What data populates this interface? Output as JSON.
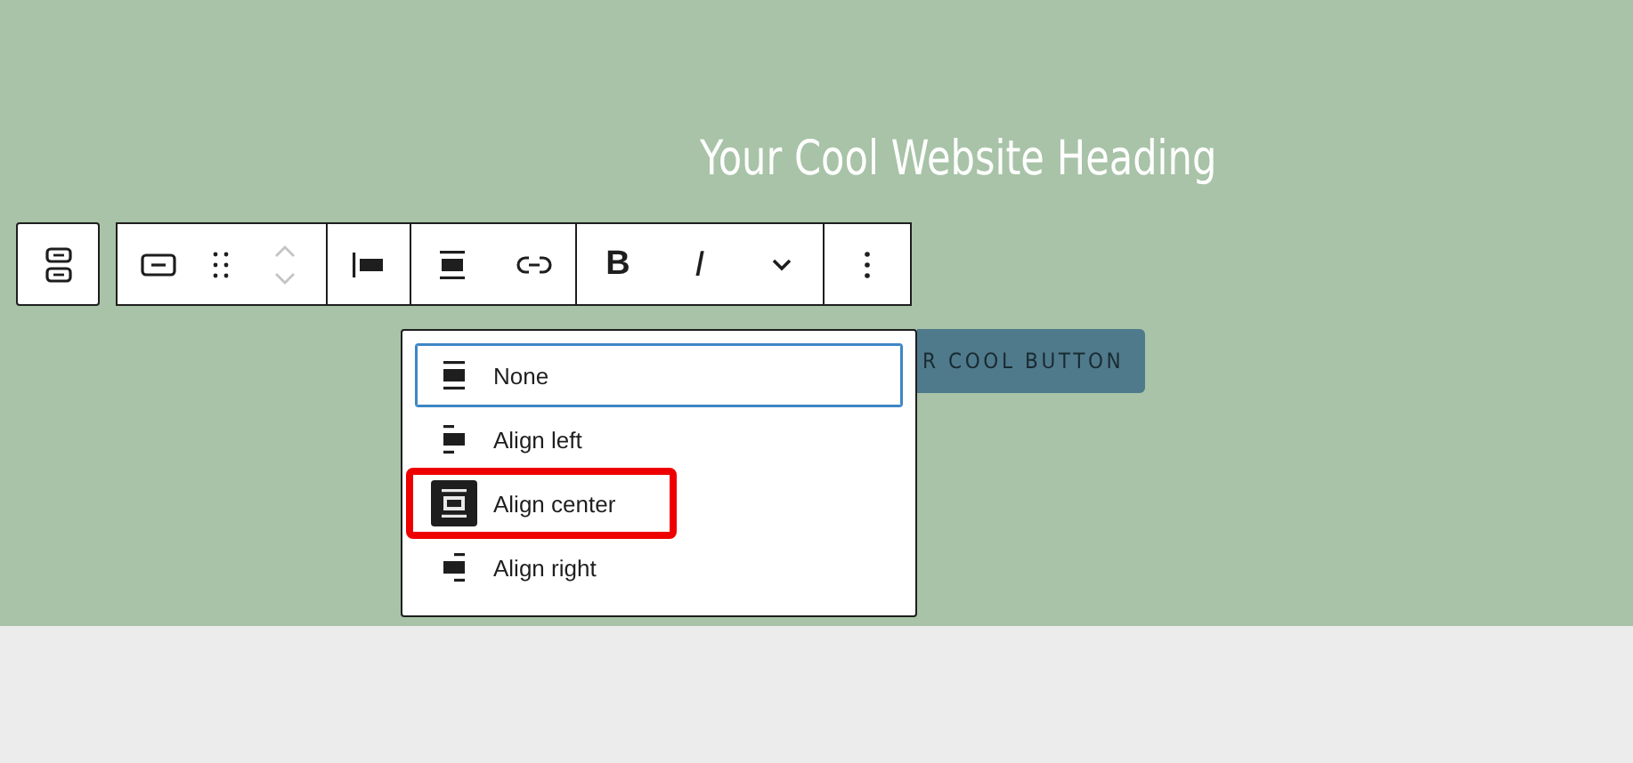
{
  "heading": "Your Cool Website Heading",
  "button": {
    "label": "R COOL BUTTON"
  },
  "toolbar": {
    "items": [
      {
        "kind": "parent"
      },
      {
        "kind": "block"
      },
      {
        "kind": "drag"
      },
      {
        "kind": "mover"
      },
      {
        "kind": "align-left"
      },
      {
        "kind": "align-center"
      },
      {
        "kind": "link"
      },
      {
        "kind": "bold",
        "label": "B"
      },
      {
        "kind": "italic",
        "label": "I"
      },
      {
        "kind": "more-caret"
      },
      {
        "kind": "options"
      }
    ]
  },
  "align_menu": {
    "items": [
      {
        "label": "None",
        "kind": "none",
        "selected": false,
        "focused": true,
        "marked": false
      },
      {
        "label": "Align left",
        "kind": "left",
        "selected": false,
        "focused": false,
        "marked": false
      },
      {
        "label": "Align center",
        "kind": "center",
        "selected": true,
        "focused": false,
        "marked": true
      },
      {
        "label": "Align right",
        "kind": "right",
        "selected": false,
        "focused": false,
        "marked": false
      }
    ]
  }
}
